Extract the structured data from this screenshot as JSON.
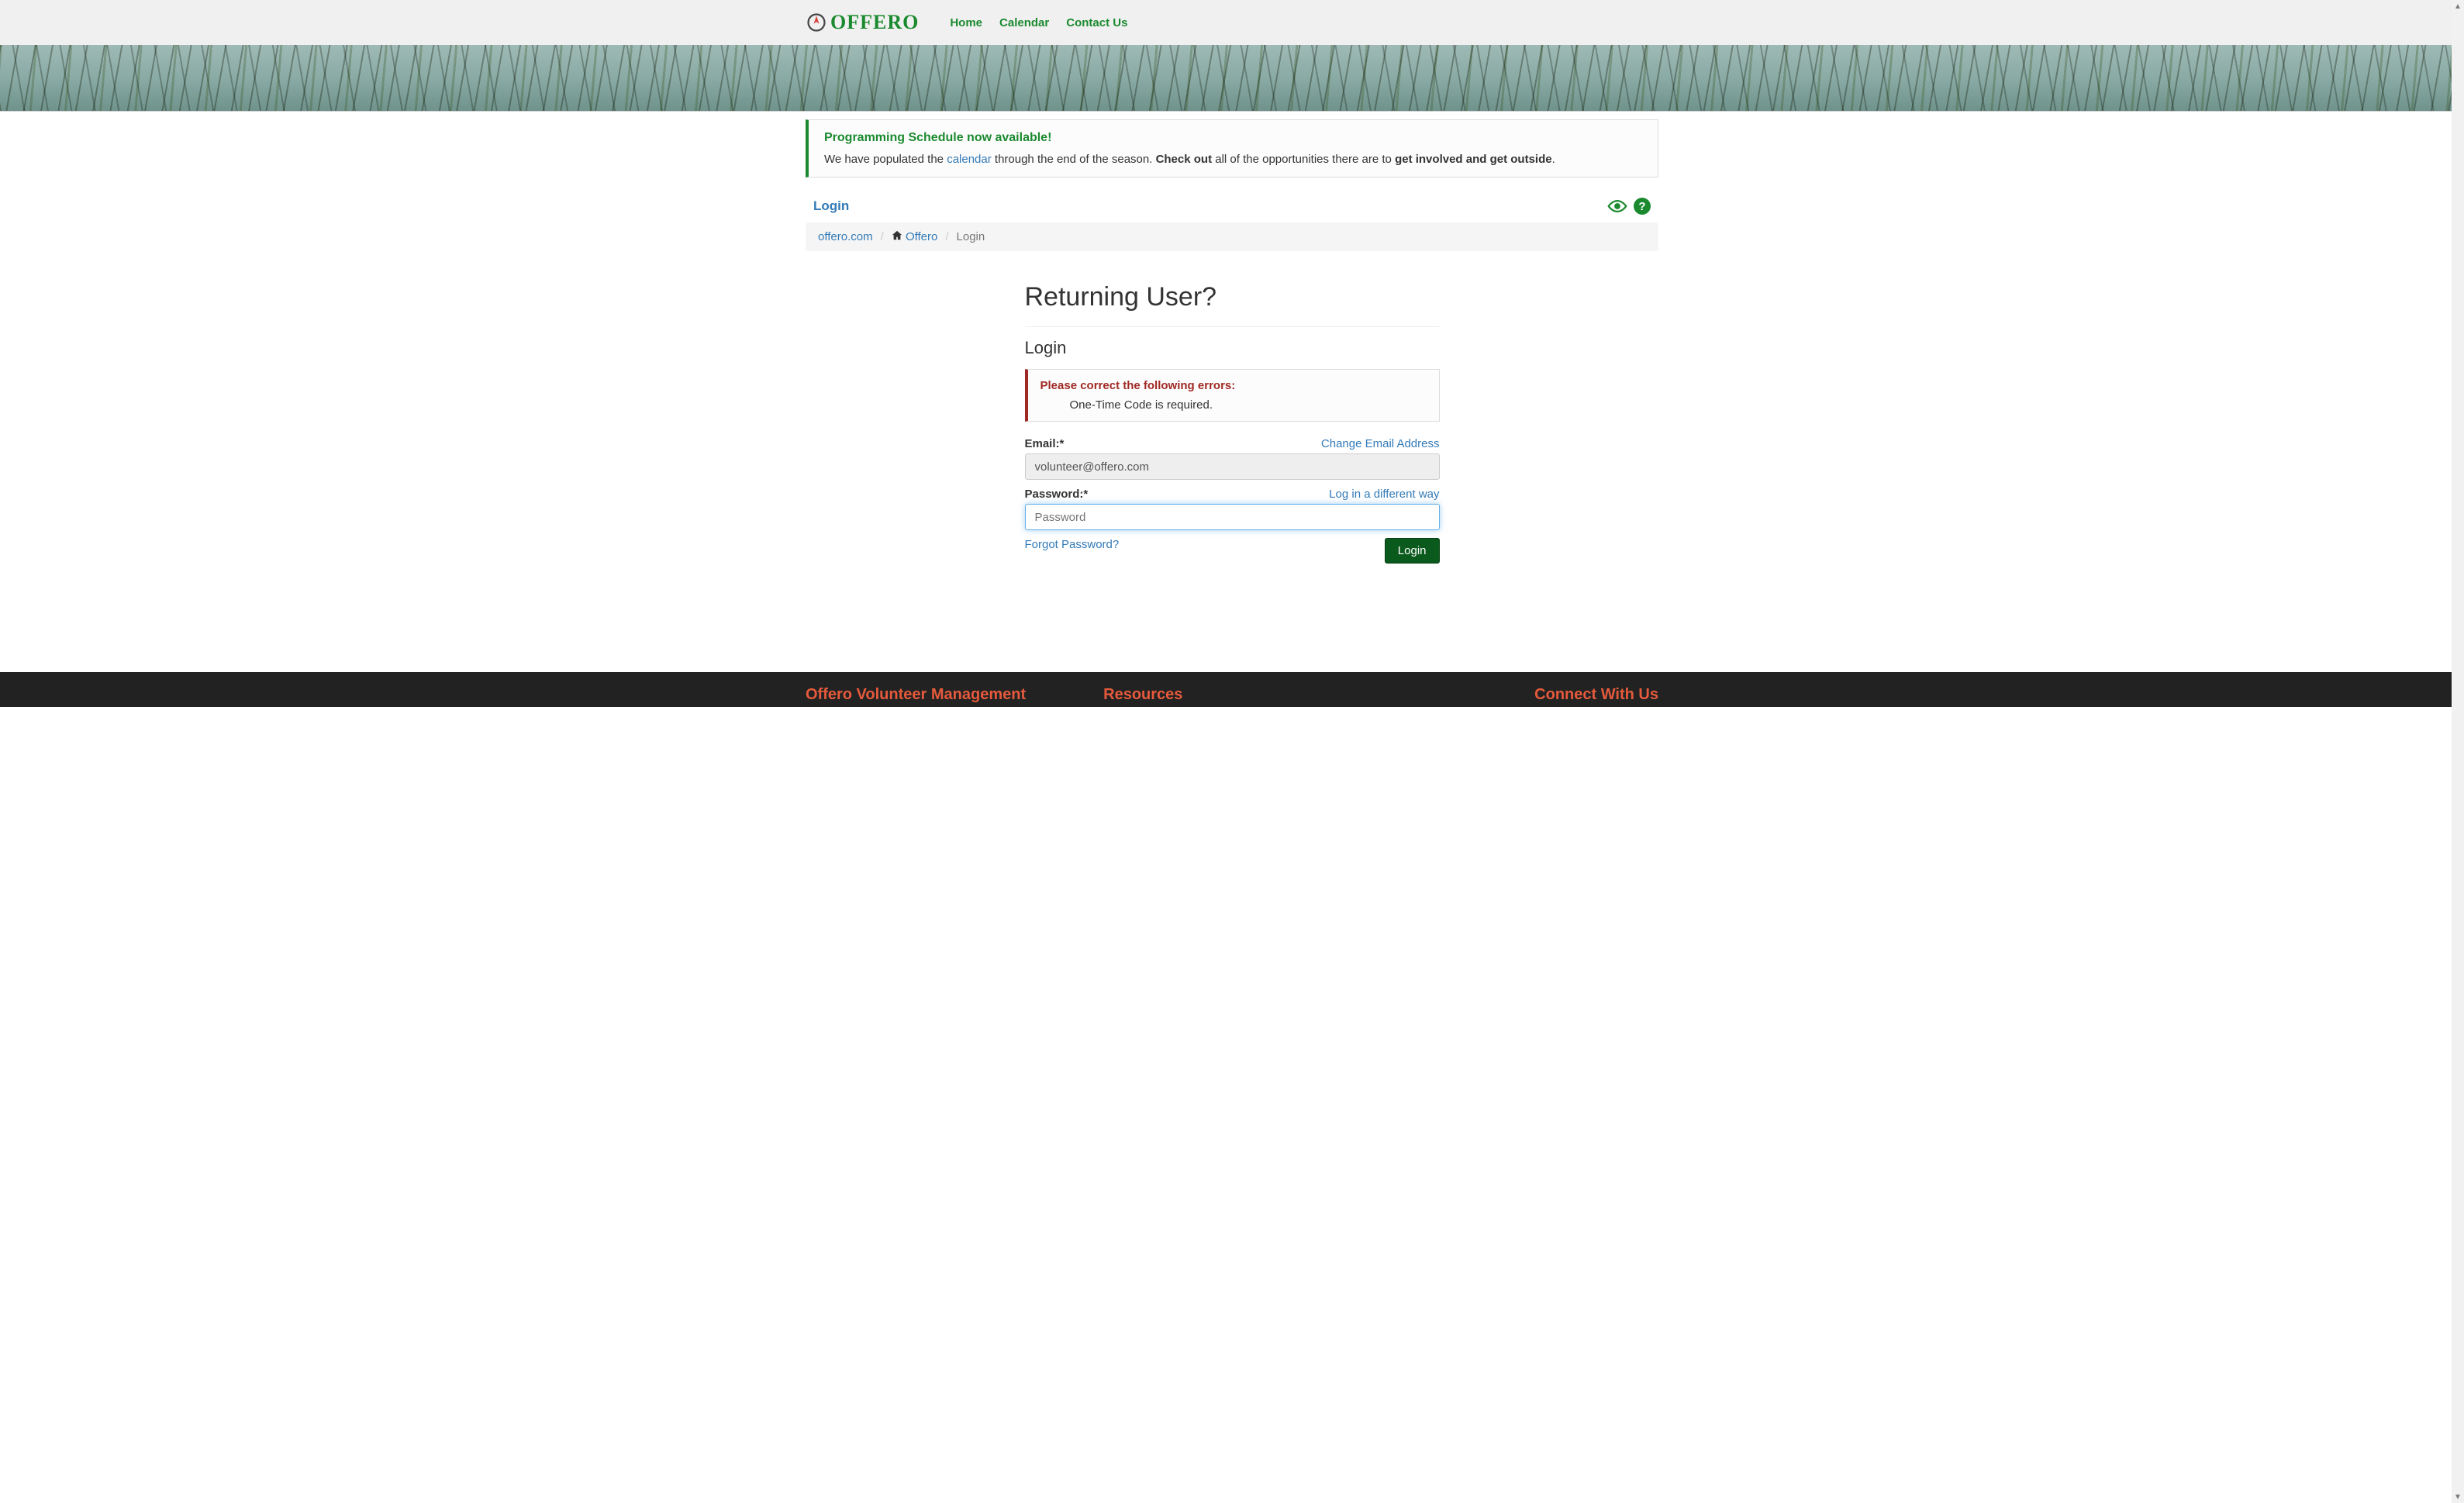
{
  "brand": {
    "name": "OFFERO"
  },
  "nav": {
    "home": "Home",
    "calendar": "Calendar",
    "contact": "Contact Us"
  },
  "callout": {
    "title": "Programming Schedule now available!",
    "line_pre": "We have populated the ",
    "calendar_link": "calendar",
    "line_mid1": " through the end of the season. ",
    "bold1": "Check out",
    "line_mid2": " all of the opportunities there are to ",
    "bold2": "get involved and get outside",
    "line_end": "."
  },
  "header": {
    "title": "Login"
  },
  "breadcrumb": {
    "root": "offero.com",
    "home": "Offero",
    "current": "Login"
  },
  "main": {
    "heading": "Returning User?",
    "subheading": "Login"
  },
  "error": {
    "title": "Please correct the following errors:",
    "items": [
      "One-Time Code is required."
    ]
  },
  "form": {
    "email_label": "Email:*",
    "change_email": "Change Email Address",
    "email_value": "volunteer@offero.com",
    "password_label": "Password:*",
    "diff_way": "Log in a different way",
    "password_placeholder": "Password",
    "forgot": "Forgot Password?",
    "login_btn": "Login"
  },
  "footer": {
    "col1": "Offero Volunteer Management",
    "col2": "Resources",
    "col3": "Connect With Us"
  }
}
